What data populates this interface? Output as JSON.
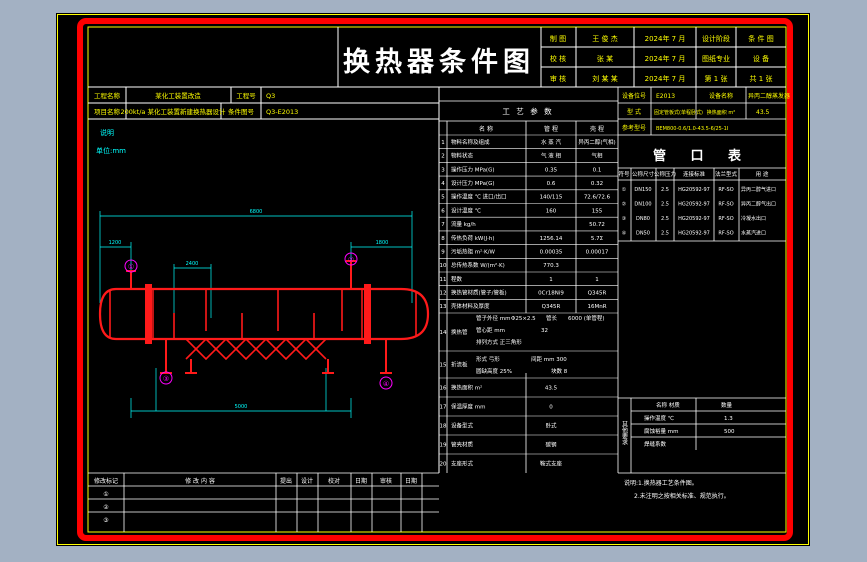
{
  "title": "换热器条件图",
  "title_block": {
    "row1": [
      "制 图",
      "王 俊 杰",
      "2024年 7 月",
      "设计阶段",
      "条 件 图"
    ],
    "row2": [
      "校 核",
      "张 某",
      "2024年 7 月",
      "图纸专业",
      "设 备"
    ],
    "row3": [
      "审 核",
      "刘 某 某",
      "2024年 7 月",
      "第 1 张",
      "共 1 张"
    ]
  },
  "info": {
    "project_label": "工程名称",
    "project_value": "某化工装置改造",
    "sub_label": "工程号",
    "sub_value": "Q3",
    "item_label": "项目名称",
    "item_value": "200kt/a 某化工装置新建换热器设计",
    "code_label": "条件图号",
    "code_value": "Q3-E2013"
  },
  "left_notes": [
    "说明",
    "单位:mm"
  ],
  "nozzles": [
    "①",
    "②",
    "③",
    "④"
  ],
  "dims": [
    "6800",
    "1200",
    "5000",
    "2400",
    "1800"
  ],
  "process": {
    "title": "工 艺 参 数",
    "headers": [
      "名 称",
      "管 程",
      "壳 程"
    ],
    "rows": [
      [
        "1",
        "物料名称及组成",
        "水 蒸 汽",
        "异丙二醇(气相)"
      ],
      [
        "2",
        "物料状态",
        "气 液 相",
        "气相"
      ],
      [
        "3",
        "操作压力 MPa(G)",
        "0.35",
        "0.1"
      ],
      [
        "4",
        "设计压力 MPa(G)",
        "0.6",
        "0.32"
      ],
      [
        "5",
        "操作温度 ℃ 进口/出口",
        "140/115",
        "72.6/72.6"
      ],
      [
        "6",
        "设计温度 ℃",
        "160",
        "155"
      ],
      [
        "7",
        "流量 kg/h",
        "",
        "50.72"
      ],
      [
        "8",
        "传热负荷 kW(J·h)",
        "1256.14",
        "5.7Σ"
      ],
      [
        "9",
        "污垢热阻 m²·K/W",
        "0.00035",
        "0.00017"
      ],
      [
        "10",
        "总传热系数 W/(m²·K)",
        "770.3",
        ""
      ],
      [
        "11",
        "程数",
        "1",
        "1"
      ],
      [
        "12",
        "换热管材质(管子/管板)",
        "0Cr18Ni9",
        "Q345R"
      ],
      [
        "13",
        "壳体材料及厚度",
        "Q345R",
        "16MnR"
      ],
      [
        "14",
        "换热管",
        "管子 Φ25×2.5",
        "管长 6000"
      ],
      [
        "15",
        "折流板",
        "形式 弓形",
        "间距 300"
      ],
      [
        "16",
        "换热面积 m²",
        "43.5",
        ""
      ],
      [
        "17",
        "保温厚度 mm",
        "0",
        ""
      ],
      [
        "18",
        "设备型式",
        "卧式",
        ""
      ],
      [
        "19",
        "管壳材质",
        "碳钢",
        ""
      ],
      [
        "20",
        "支座形式",
        "鞍式支座",
        ""
      ]
    ],
    "tube_detail": [
      "管子外径 mm",
      "Φ25×2.5",
      "管长",
      "6000 (单管程)",
      "管心距 mm",
      "32",
      "排列方式 正三角形"
    ],
    "baffle_detail": [
      "形式 弓形",
      "间距 mm 300",
      "圆缺高度 25%",
      "块数 8"
    ]
  },
  "right_header": {
    "rows": [
      [
        "设备位号",
        "E2013",
        "设备名称",
        "异丙二醇蒸发器"
      ],
      [
        "型 式",
        "固定管板式(单程卧式)",
        "换热面积 m²",
        "43.5"
      ],
      [
        "参考型号",
        "BEM800-0.6/1.0-43.5-6/25-1I",
        "",
        ""
      ]
    ]
  },
  "nozzle_table": {
    "title": "管 口 表",
    "headers": [
      "符号",
      "公称尺寸",
      "公称压力",
      "连接标准",
      "法兰型式",
      "用 途"
    ],
    "rows": [
      [
        "①",
        "DN150",
        "2.5",
        "HG20592-97",
        "RF-SO",
        "异丙二醇气进口"
      ],
      [
        "②",
        "DN100",
        "2.5",
        "HG20592-97",
        "RF-SO",
        "异丙二醇气出口"
      ],
      [
        "③",
        "DN80",
        "2.5",
        "HG20592-97",
        "RF-SO",
        "冷凝水出口"
      ],
      [
        "④",
        "DN50",
        "2.5",
        "HG20592-97",
        "RF-SO",
        "水蒸汽进口"
      ]
    ]
  },
  "other": {
    "label": "其他要求",
    "rows": [
      [
        "名称 材质",
        "数量"
      ],
      [
        "操作温度 ℃",
        "1.3"
      ],
      [
        "腐蚀裕量 mm",
        "500"
      ],
      [
        "焊缝系数",
        ""
      ]
    ]
  },
  "notes": [
    "说明:1.换热器工艺条件图。",
    "2.未注明之按相关标准、规范执行。"
  ],
  "revision": {
    "headers": [
      "修改标记",
      "修 改 内 容",
      "提出",
      "设计",
      "校对",
      "日期",
      "审核",
      "日期"
    ],
    "marks": [
      "①",
      "②",
      "③"
    ]
  },
  "colors": {
    "frame": "#ff0000",
    "line": "#ffffff",
    "dim": "#00ffff",
    "yellow": "#ffff00",
    "magenta": "#ff00ff",
    "vessel": "#ff1a1a"
  }
}
